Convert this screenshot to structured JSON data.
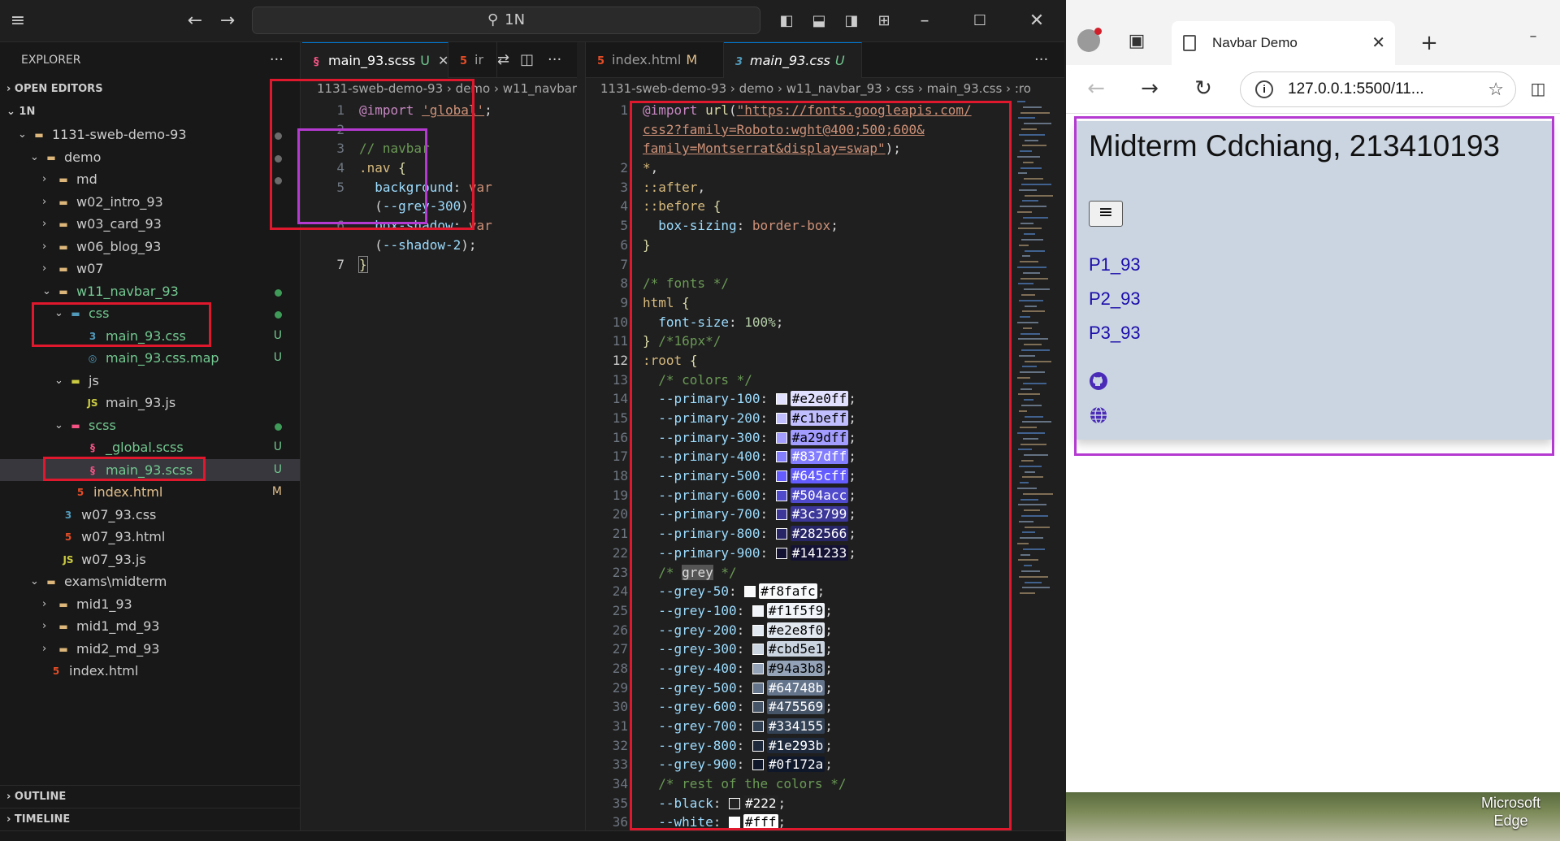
{
  "vscode": {
    "command_center": "1N",
    "explorer": {
      "title": "EXPLORER",
      "open_editors": "OPEN EDITORS",
      "root": "1N",
      "tree": [
        {
          "label": "1131-sweb-demo-93",
          "type": "folder",
          "open": true,
          "status": "dot"
        },
        {
          "label": "demo",
          "type": "folder",
          "open": true,
          "status": "dot"
        },
        {
          "label": "md",
          "type": "folder",
          "open": false,
          "status": "dot"
        },
        {
          "label": "w02_intro_93",
          "type": "folder",
          "open": false,
          "status": ""
        },
        {
          "label": "w03_card_93",
          "type": "folder",
          "open": false,
          "status": ""
        },
        {
          "label": "w06_blog_93",
          "type": "folder",
          "open": false,
          "status": ""
        },
        {
          "label": "w07",
          "type": "folder",
          "open": false,
          "status": ""
        },
        {
          "label": "w11_navbar_93",
          "type": "folder",
          "open": true,
          "status": "green-dot"
        },
        {
          "label": "css",
          "type": "css-folder",
          "open": true,
          "status": "green-dot"
        },
        {
          "label": "main_93.css",
          "type": "css",
          "status": "U"
        },
        {
          "label": "main_93.css.map",
          "type": "map",
          "status": "U"
        },
        {
          "label": "js",
          "type": "js-folder",
          "open": true,
          "status": ""
        },
        {
          "label": "main_93.js",
          "type": "js",
          "status": ""
        },
        {
          "label": "scss",
          "type": "scss-folder",
          "open": true,
          "status": "green-dot"
        },
        {
          "label": "_global.scss",
          "type": "scss",
          "status": "U"
        },
        {
          "label": "main_93.scss",
          "type": "scss",
          "status": "U"
        },
        {
          "label": "index.html",
          "type": "html",
          "status": "M"
        },
        {
          "label": "w07_93.css",
          "type": "css",
          "status": ""
        },
        {
          "label": "w07_93.html",
          "type": "html",
          "status": ""
        },
        {
          "label": "w07_93.js",
          "type": "js",
          "status": ""
        },
        {
          "label": "exams\\midterm",
          "type": "folder",
          "open": true,
          "status": ""
        },
        {
          "label": "mid1_93",
          "type": "folder",
          "open": false,
          "status": ""
        },
        {
          "label": "mid1_md_93",
          "type": "folder",
          "open": false,
          "status": ""
        },
        {
          "label": "mid2_md_93",
          "type": "folder",
          "open": false,
          "status": ""
        },
        {
          "label": "index.html",
          "type": "html",
          "status": ""
        }
      ],
      "outline": "OUTLINE",
      "timeline": "TIMELINE"
    },
    "left_editor": {
      "tabs": [
        {
          "name": "main_93.scss",
          "status": "U",
          "active": true
        },
        {
          "name": "ir",
          "status": "",
          "active": false
        }
      ],
      "breadcrumb": "1131-sweb-demo-93 › demo › w11_navbar_",
      "lines": [
        "@import 'global';",
        "",
        "// navbar",
        ".nav {",
        "  background: var",
        "  (--grey-300);",
        "  box-shadow: var",
        "  (--shadow-2);",
        "}"
      ]
    },
    "right_editor": {
      "tabs": [
        {
          "name": "index.html",
          "status": "M",
          "active": false
        },
        {
          "name": "main_93.css",
          "status": "U",
          "active": true
        }
      ],
      "breadcrumb": "1131-sweb-demo-93 › demo › w11_navbar_93 › css › main_93.css › :ro",
      "import_lines": [
        "\"https://fonts.googleapis.com/",
        "css2?family=Roboto:wght@400;500;600&",
        "family=Montserrat&display=swap\""
      ],
      "line_numbers": [
        "1",
        "",
        "",
        "2",
        "3",
        "4",
        "5",
        "6",
        "7",
        "8",
        "9",
        "10",
        "11",
        "12",
        "13",
        "14",
        "15",
        "16",
        "17",
        "18",
        "19",
        "20",
        "21",
        "22",
        "23",
        "24",
        "25",
        "26",
        "27",
        "28",
        "29",
        "30",
        "31",
        "32",
        "33",
        "34",
        "35",
        "36"
      ],
      "primary": [
        {
          "name": "--primary-100",
          "hex": "#e2e0ff"
        },
        {
          "name": "--primary-200",
          "hex": "#c1beff"
        },
        {
          "name": "--primary-300",
          "hex": "#a29dff"
        },
        {
          "name": "--primary-400",
          "hex": "#837dff"
        },
        {
          "name": "--primary-500",
          "hex": "#645cff"
        },
        {
          "name": "--primary-600",
          "hex": "#504acc"
        },
        {
          "name": "--primary-700",
          "hex": "#3c3799"
        },
        {
          "name": "--primary-800",
          "hex": "#282566"
        },
        {
          "name": "--primary-900",
          "hex": "#141233"
        }
      ],
      "grey": [
        {
          "name": "--grey-50",
          "hex": "#f8fafc"
        },
        {
          "name": "--grey-100",
          "hex": "#f1f5f9"
        },
        {
          "name": "--grey-200",
          "hex": "#e2e8f0"
        },
        {
          "name": "--grey-300",
          "hex": "#cbd5e1"
        },
        {
          "name": "--grey-400",
          "hex": "#94a3b8"
        },
        {
          "name": "--grey-500",
          "hex": "#64748b"
        },
        {
          "name": "--grey-600",
          "hex": "#475569"
        },
        {
          "name": "--grey-700",
          "hex": "#334155"
        },
        {
          "name": "--grey-800",
          "hex": "#1e293b"
        },
        {
          "name": "--grey-900",
          "hex": "#0f172a"
        }
      ],
      "rest": [
        {
          "name": "--black",
          "hex": "#222"
        },
        {
          "name": "--white",
          "hex": "#fff"
        }
      ]
    }
  },
  "browser": {
    "tab_title": "Navbar Demo",
    "url": "127.0.0.1:5500/11...",
    "page": {
      "heading": "Midterm Cdchiang, 213410193",
      "menu_glyph": "≡",
      "links": [
        "P1_93",
        "P2_93",
        "P3_93"
      ],
      "nav_bg": "#cbd5e1"
    }
  },
  "desktop": {
    "label_line1": "Microsoft",
    "label_line2": "Edge"
  },
  "colors": {
    "annotation_red": "#e0182d",
    "annotation_magenta": "#b53ad1",
    "accent": "#0078d4"
  }
}
